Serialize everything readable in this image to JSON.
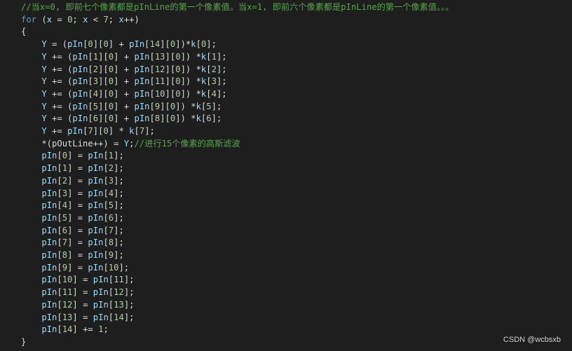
{
  "code": {
    "lines": [
      "//当x=0, 即前七个像素都是pInLine的第一个像素值。当x=1, 即前六个像素都是pInLine的第一个像素值。。。",
      "for (x = 0; x < 7; x++)",
      "{",
      "    Y = (pIn[0][0] + pIn[14][0])*k[0];",
      "    Y += (pIn[1][0] + pIn[13][0]) *k[1];",
      "    Y += (pIn[2][0] + pIn[12][0]) *k[2];",
      "    Y += (pIn[3][0] + pIn[11][0]) *k[3];",
      "    Y += (pIn[4][0] + pIn[10][0]) *k[4];",
      "    Y += (pIn[5][0] + pIn[9][0]) *k[5];",
      "    Y += (pIn[6][0] + pIn[8][0]) *k[6];",
      "    Y += pIn[7][0] * k[7];",
      "    *(pOutLine++) = Y;//进行15个像素的高斯滤波",
      "    pIn[0] = pIn[1];",
      "    pIn[1] = pIn[2];",
      "    pIn[2] = pIn[3];",
      "    pIn[3] = pIn[4];",
      "    pIn[4] = pIn[5];",
      "    pIn[5] = pIn[6];",
      "    pIn[6] = pIn[7];",
      "    pIn[7] = pIn[8];",
      "    pIn[8] = pIn[9];",
      "    pIn[9] = pIn[10];",
      "    pIn[10] = pIn[11];",
      "    pIn[11] = pIn[12];",
      "    pIn[12] = pIn[13];",
      "    pIn[13] = pIn[14];",
      "    pIn[14] += 1;",
      "}"
    ]
  },
  "watermark": "CSDN @wcbsxb",
  "colors": {
    "background": "#1e1e1e",
    "comment": "#57a64a",
    "keyword": "#569cd6",
    "variable": "#9cdcfe",
    "number": "#b5cea8",
    "text": "#dcdcdc"
  }
}
